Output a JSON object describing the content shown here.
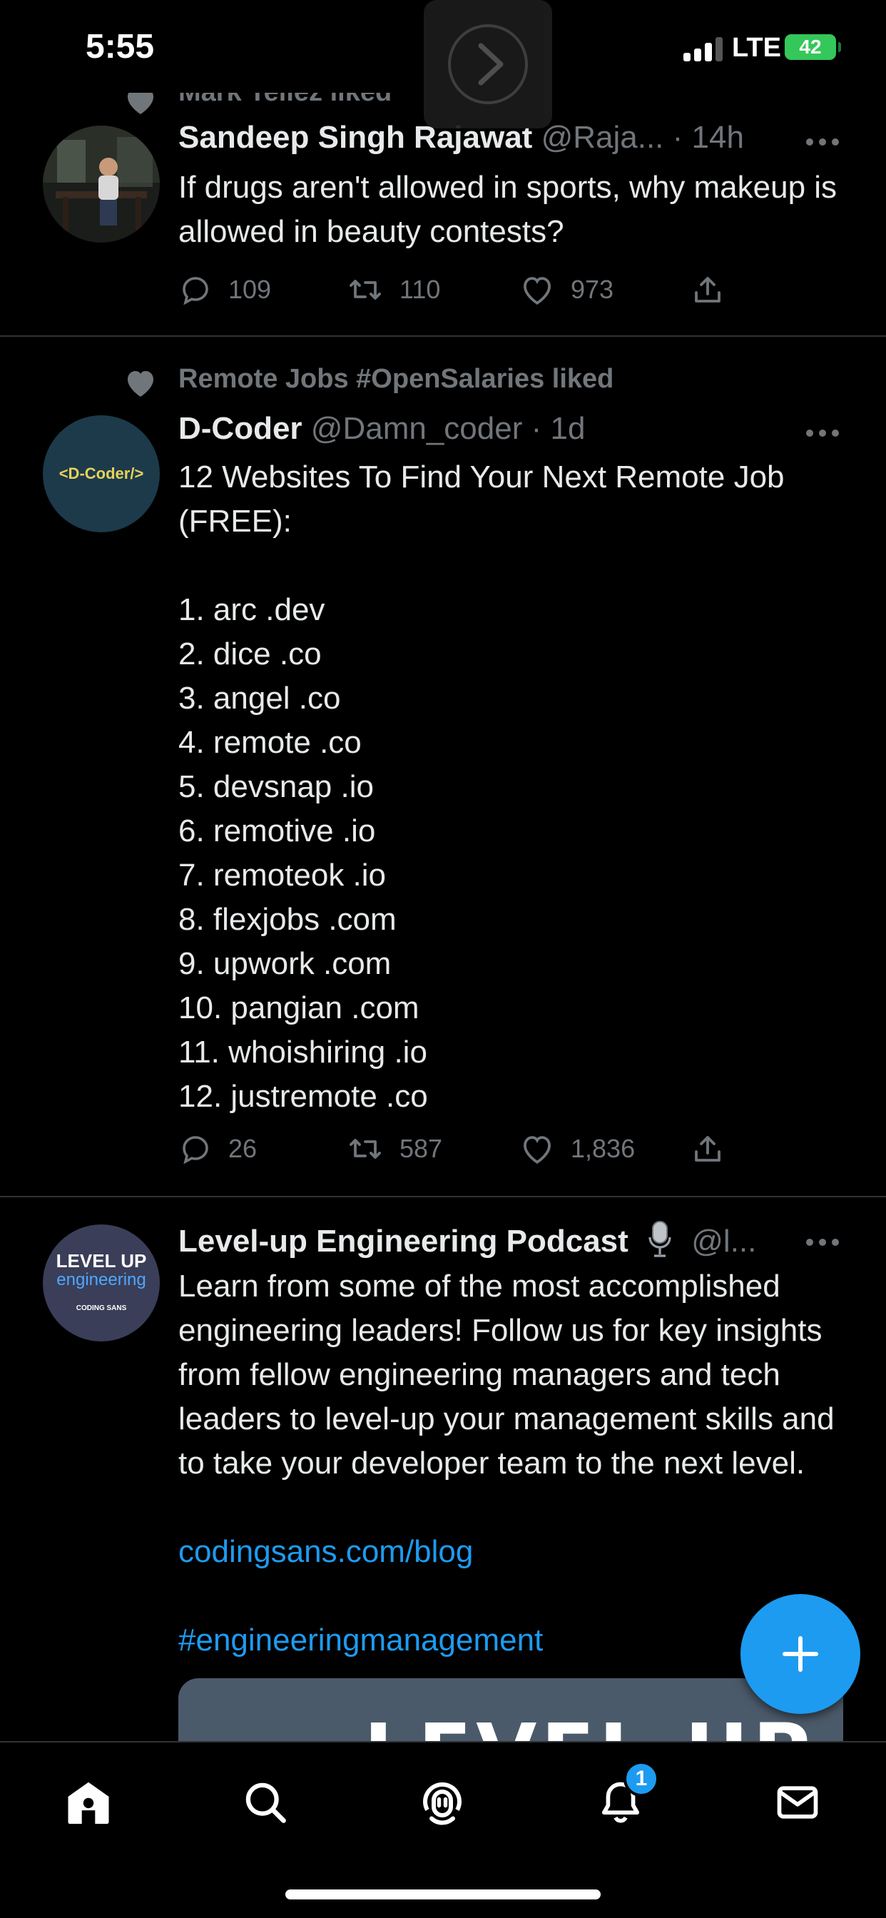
{
  "status_bar": {
    "time": "5:55",
    "network": "LTE",
    "battery": "42"
  },
  "timeline": {
    "tweets": [
      {
        "context": "Mark Tellez liked",
        "name": "Sandeep Singh Rajawat",
        "handle": "@Raja...",
        "time": "· 14h",
        "text": "If drugs aren't allowed in sports, why makeup is allowed in beauty contests?",
        "replies": "109",
        "retweets": "110",
        "likes": "973"
      },
      {
        "context": "Remote Jobs #OpenSalaries liked",
        "name": "D-Coder",
        "handle": "@Damn_coder",
        "time": "· 1d",
        "avatar_label": "<D-Coder/>",
        "text": "12 Websites To Find Your Next Remote Job (FREE):\n\n1. arc .dev\n2. dice .co\n3. angel .co\n4. remote .co\n5. devsnap .io\n6. remotive .io\n7. remoteok .io\n8. flexjobs .com\n9. upwork .com\n10. pangian .com\n11. whoishiring .io\n12. justremote .co",
        "replies": "26",
        "retweets": "587",
        "likes": "1,836"
      },
      {
        "name": "Level-up Engineering Podcast",
        "handle": "@l...",
        "avatar_line1": "LEVEL UP",
        "avatar_line2": "engineering",
        "avatar_line3": "CODING SANS",
        "text": "Learn from some of the most accomplished engineering leaders! Follow us for key insights from fellow engineering managers and tech leaders to level-up your management skills and to take your developer team to the next level.",
        "link": "codingsans.com/blog",
        "hashtag": "#engineeringmanagement",
        "media_text": "LEVEL UP"
      }
    ]
  },
  "bottom_nav": {
    "items": [
      "home-icon",
      "search-icon",
      "spaces-icon",
      "notifications-icon",
      "messages-icon"
    ],
    "notifications_badge": "1"
  },
  "colors": {
    "accent": "#1d9bf0",
    "muted": "#71767b",
    "divider": "#2f3336",
    "battery": "#34c759"
  }
}
